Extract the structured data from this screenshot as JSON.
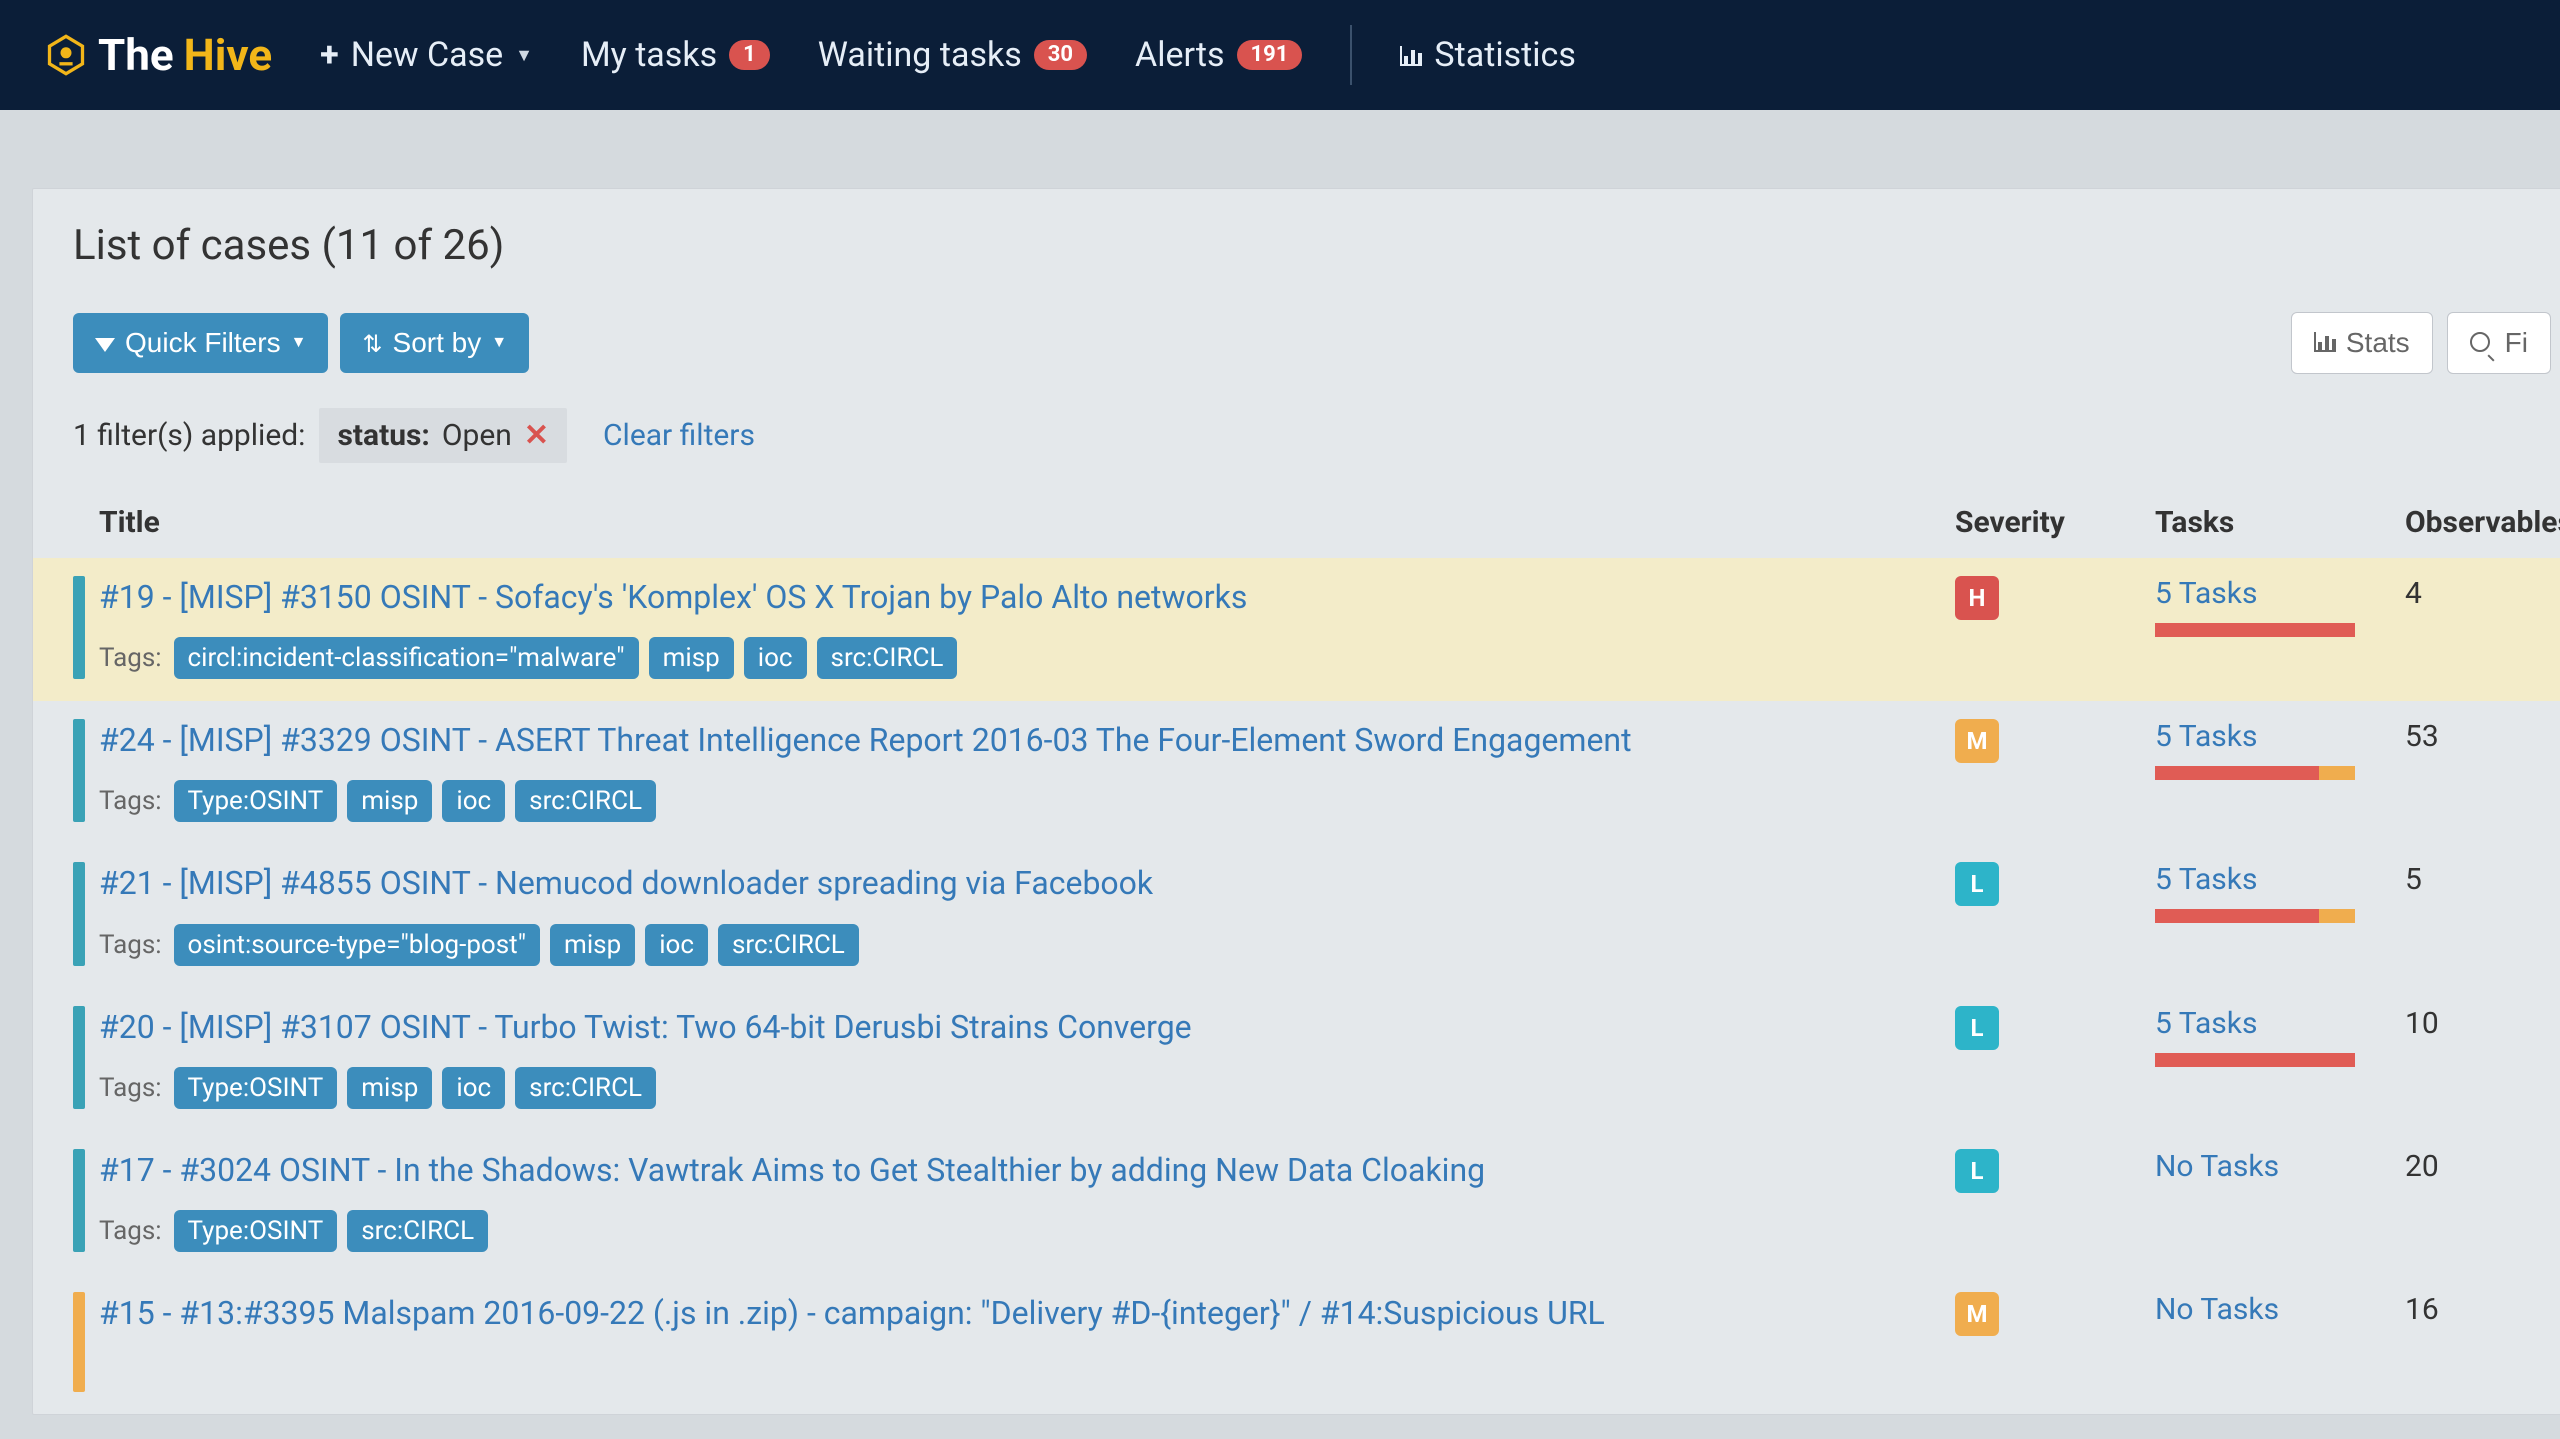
{
  "brand": {
    "the": "The",
    "hive": "Hive"
  },
  "nav": {
    "newCase": "New Case",
    "myTasks": {
      "label": "My tasks",
      "count": "1"
    },
    "waitingTasks": {
      "label": "Waiting tasks",
      "count": "30"
    },
    "alerts": {
      "label": "Alerts",
      "count": "191"
    },
    "statistics": "Statistics"
  },
  "page": {
    "title": "List of cases (11 of 26)",
    "quickFilters": "Quick Filters",
    "sortBy": "Sort by",
    "statsBtn": "Stats",
    "findBtn": "Fi",
    "filtersApplied": "1 filter(s) applied:",
    "filterLabel": "status:",
    "filterValue": "Open",
    "clear": "Clear filters"
  },
  "cols": {
    "title": "Title",
    "severity": "Severity",
    "tasks": "Tasks",
    "observables": "Observables"
  },
  "tagsLabel": "Tags:",
  "cases": [
    {
      "title": "#19 - [MISP] #3150 OSINT - Sofacy's 'Komplex' OS X Trojan by Palo Alto networks",
      "tags": [
        "circl:incident-classification=\"malware\"",
        "misp",
        "ioc",
        "src:CIRCL"
      ],
      "sev": "H",
      "tasks": "5 Tasks",
      "barRed": 100,
      "barYellow": 0,
      "obs": "4",
      "highlight": true
    },
    {
      "title": "#24 - [MISP] #3329 OSINT - ASERT Threat Intelligence Report 2016-03 The Four-Element Sword Engagement",
      "tags": [
        "Type:OSINT",
        "misp",
        "ioc",
        "src:CIRCL"
      ],
      "sev": "M",
      "tasks": "5 Tasks",
      "barRed": 82,
      "barYellow": 18,
      "obs": "53"
    },
    {
      "title": "#21 - [MISP] #4855 OSINT - Nemucod downloader spreading via Facebook",
      "tags": [
        "osint:source-type=\"blog-post\"",
        "misp",
        "ioc",
        "src:CIRCL"
      ],
      "sev": "L",
      "tasks": "5 Tasks",
      "barRed": 82,
      "barYellow": 18,
      "obs": "5"
    },
    {
      "title": "#20 - [MISP] #3107 OSINT - Turbo Twist: Two 64-bit Derusbi Strains Converge",
      "tags": [
        "Type:OSINT",
        "misp",
        "ioc",
        "src:CIRCL"
      ],
      "sev": "L",
      "tasks": "5 Tasks",
      "barRed": 100,
      "barYellow": 0,
      "obs": "10"
    },
    {
      "title": "#17 - #3024 OSINT - In the Shadows: Vawtrak Aims to Get Stealthier by adding New Data Cloaking",
      "tags": [
        "Type:OSINT",
        "src:CIRCL"
      ],
      "sev": "L",
      "tasks": "No Tasks",
      "barRed": 0,
      "barYellow": 0,
      "obs": "20"
    },
    {
      "title": "#15 - #13:#3395 Malspam 2016-09-22 (.js in .zip) - campaign: \"Delivery #D-{integer}\" / #14:Suspicious URL",
      "tags": [],
      "sev": "M",
      "tasks": "No Tasks",
      "barRed": 0,
      "barYellow": 0,
      "obs": "16",
      "stripe": "orange"
    }
  ]
}
